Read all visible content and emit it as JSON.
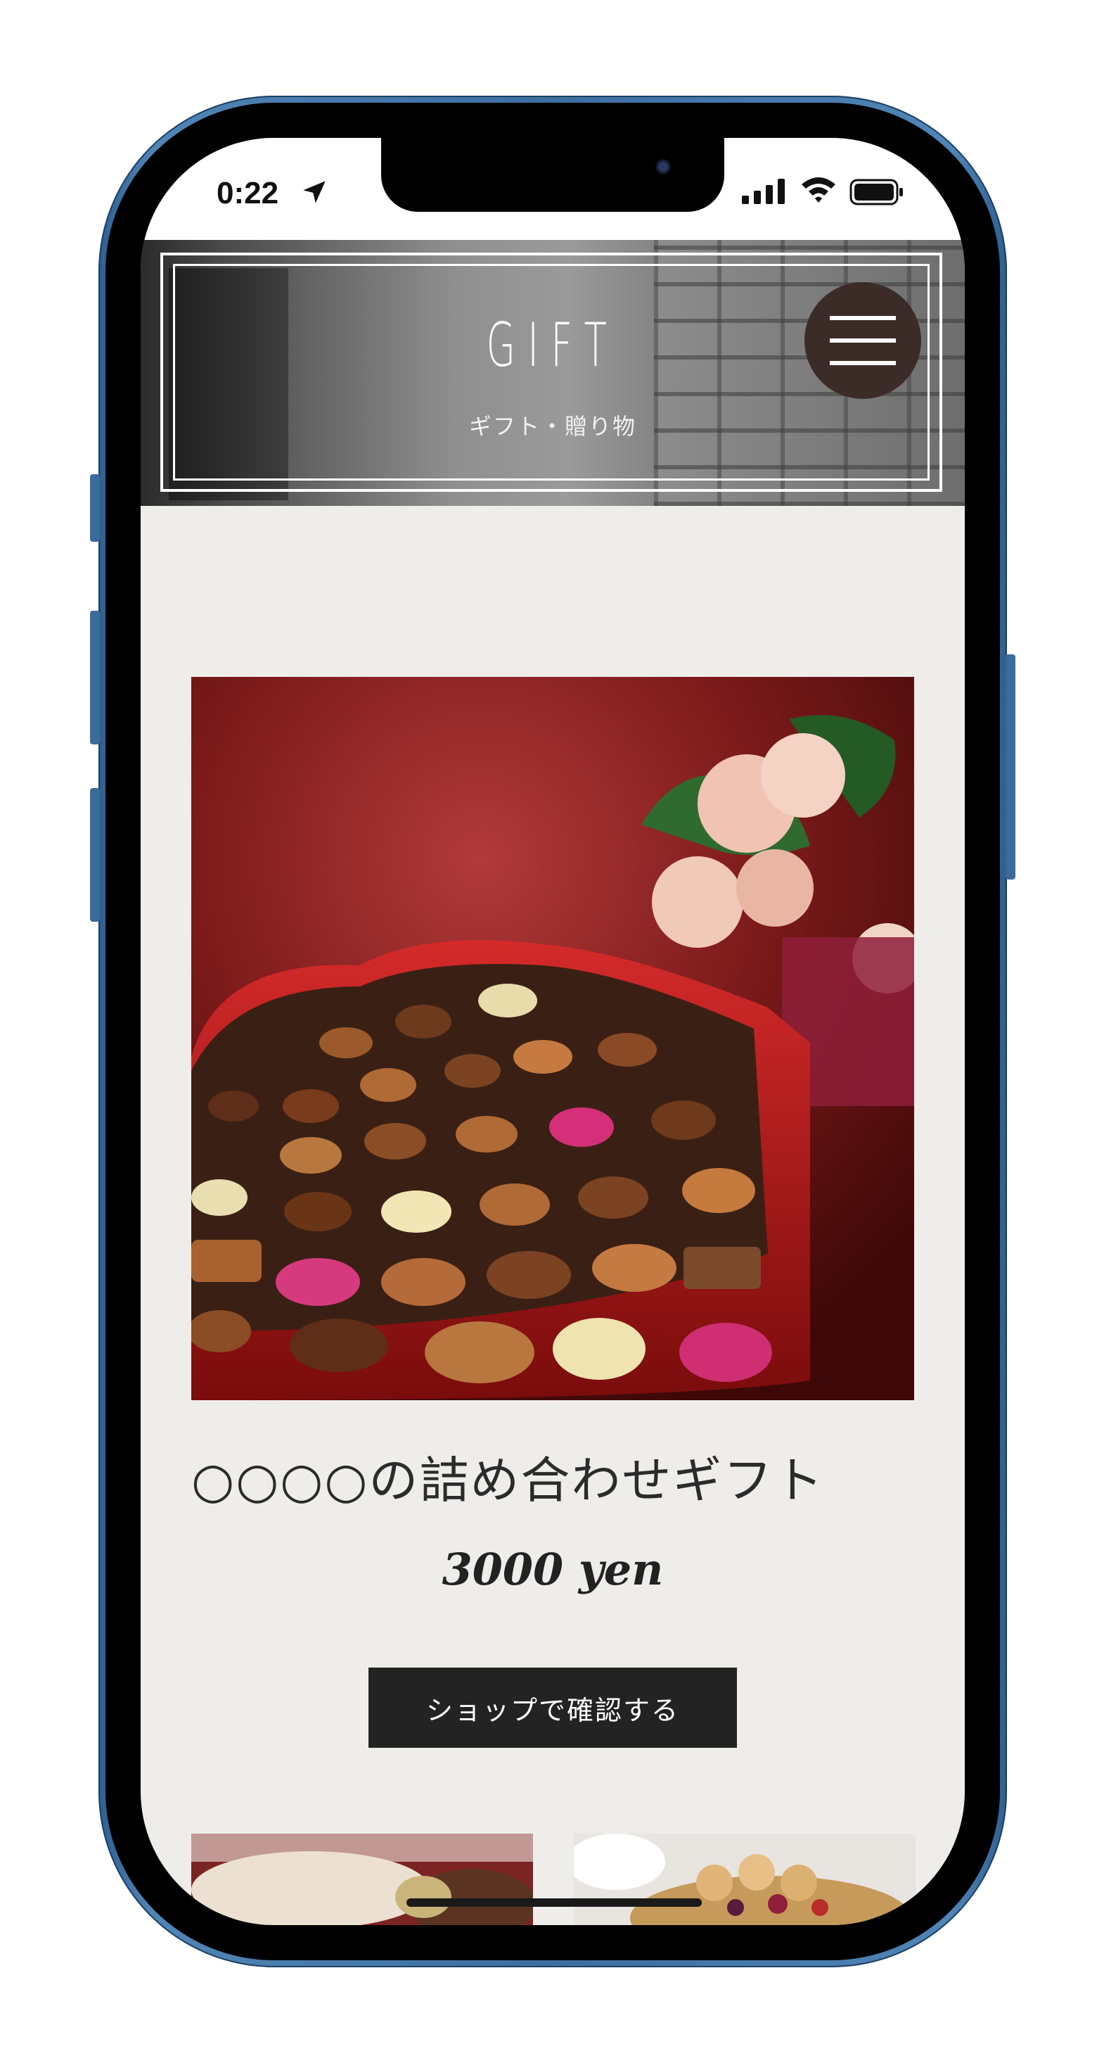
{
  "status_bar": {
    "time": "0:22",
    "icons": [
      "location-arrow-icon",
      "cellular-signal-icon",
      "wifi-icon",
      "battery-icon"
    ]
  },
  "header": {
    "title": "GIFT",
    "subtitle": "ギフト・贈り物",
    "menu_icon": "hamburger-menu-icon"
  },
  "product": {
    "image": "heart-shaped-chocolate-box-photo",
    "title": "○○○○の詰め合わせギフト",
    "price": "3000 yen",
    "button_label": "ショップで確認する"
  },
  "more_products": [
    {
      "image": "dessert-plate-photo"
    },
    {
      "image": "fruit-tart-photo"
    }
  ],
  "colors": {
    "page_background": "#efedea",
    "button_background": "#232323",
    "menu_button": "#3b2c27",
    "phone_frame": "#3f72a3"
  }
}
